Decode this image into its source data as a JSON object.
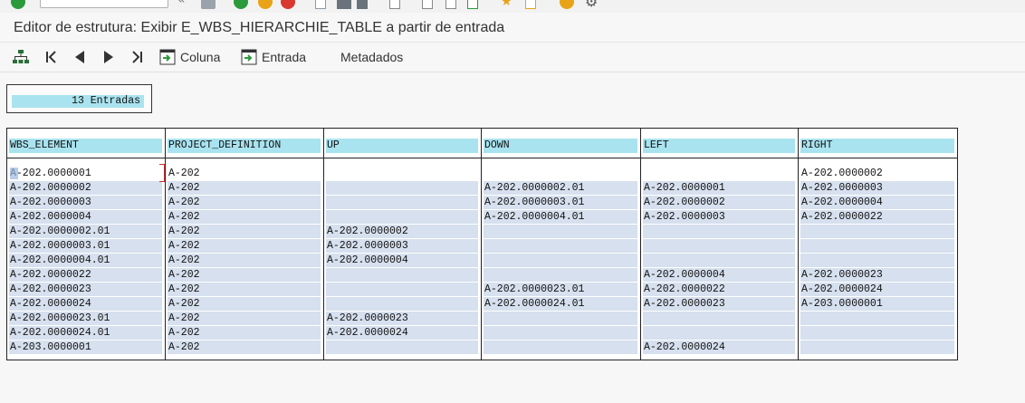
{
  "title": "Editor de estrutura: Exibir E_WBS_HIERARCHIE_TABLE a partir de entrada",
  "toolbar": {
    "coluna_label": "Coluna",
    "entrada_label": "Entrada",
    "metadados_label": "Metadados"
  },
  "entries_label": "13 Entradas",
  "table": {
    "columns": [
      "WBS_ELEMENT",
      "PROJECT_DEFINITION",
      "UP",
      "DOWN",
      "LEFT",
      "RIGHT"
    ],
    "rows": [
      [
        "A-202.0000001",
        "A-202",
        "",
        "",
        "",
        "A-202.0000002"
      ],
      [
        "A-202.0000002",
        "A-202",
        "",
        "A-202.0000002.01",
        "A-202.0000001",
        "A-202.0000003"
      ],
      [
        "A-202.0000003",
        "A-202",
        "",
        "A-202.0000003.01",
        "A-202.0000002",
        "A-202.0000004"
      ],
      [
        "A-202.0000004",
        "A-202",
        "",
        "A-202.0000004.01",
        "A-202.0000003",
        "A-202.0000022"
      ],
      [
        "A-202.0000002.01",
        "A-202",
        "A-202.0000002",
        "",
        "",
        ""
      ],
      [
        "A-202.0000003.01",
        "A-202",
        "A-202.0000003",
        "",
        "",
        ""
      ],
      [
        "A-202.0000004.01",
        "A-202",
        "A-202.0000004",
        "",
        "",
        ""
      ],
      [
        "A-202.0000022",
        "A-202",
        "",
        "",
        "A-202.0000004",
        "A-202.0000023"
      ],
      [
        "A-202.0000023",
        "A-202",
        "",
        "A-202.0000023.01",
        "A-202.0000022",
        "A-202.0000024"
      ],
      [
        "A-202.0000024",
        "A-202",
        "",
        "A-202.0000024.01",
        "A-202.0000023",
        "A-203.0000001"
      ],
      [
        "A-202.0000023.01",
        "A-202",
        "A-202.0000023",
        "",
        "",
        ""
      ],
      [
        "A-202.0000024.01",
        "A-202",
        "A-202.0000024",
        "",
        "",
        ""
      ],
      [
        "A-203.0000001",
        "A-202",
        "",
        "",
        "A-202.0000024",
        ""
      ]
    ]
  },
  "colors": {
    "header_bg": "#a9e3ef",
    "row_bg": "#d6e0ee",
    "enter_green": "#2b9a3b",
    "cancel_red": "#d9382f",
    "exit_orange": "#e8a317"
  }
}
